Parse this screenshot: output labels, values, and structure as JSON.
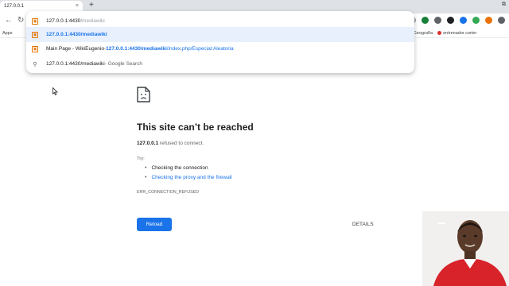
{
  "browser": {
    "tab_title": "127.0.0.1",
    "new_tab_symbol": "+",
    "tab_close_symbol": "×",
    "window_control": "⧉",
    "address": {
      "typed": "127.0.0.1:4430",
      "completion": "/mediawiki"
    },
    "bookmarks": {
      "left": "Apps",
      "right_1": "de Geografía",
      "right_2": "entrenador corter"
    }
  },
  "omnibox": {
    "rows": [
      {
        "kind": "input",
        "typed": "127.0.0.1:4430",
        "completion": "/mediawiki",
        "icon": "mediawiki-favicon"
      },
      {
        "kind": "url",
        "text": "127.0.0.1:4430/mediawiki",
        "icon": "mediawiki-favicon",
        "selected": true
      },
      {
        "kind": "history",
        "title": "Main Page - WikiEugenio",
        "separator": " - ",
        "url_bold": "127.0.0.1:4430/mediawiki",
        "url_rest": "/index.php/Especial:Aleatoria",
        "icon": "mediawiki-favicon"
      },
      {
        "kind": "search",
        "query": "127.0.0.1:4430/mediawiki",
        "suffix": " - Google Search",
        "icon": "search-icon"
      }
    ]
  },
  "error_page": {
    "title": "This site can’t be reached",
    "host": "127.0.0.1",
    "description": " refused to connect.",
    "try_label": "Try:",
    "suggestions": [
      "Checking the connection",
      "Checking the proxy and the firewall"
    ],
    "error_code": "ERR_CONNECTION_REFUSED",
    "reload_label": "Reload",
    "details_label": "DETAILS"
  },
  "colors": {
    "accent": "#1a73e8",
    "favicon": "#e37400",
    "selected_row": "#e8f0fe"
  }
}
